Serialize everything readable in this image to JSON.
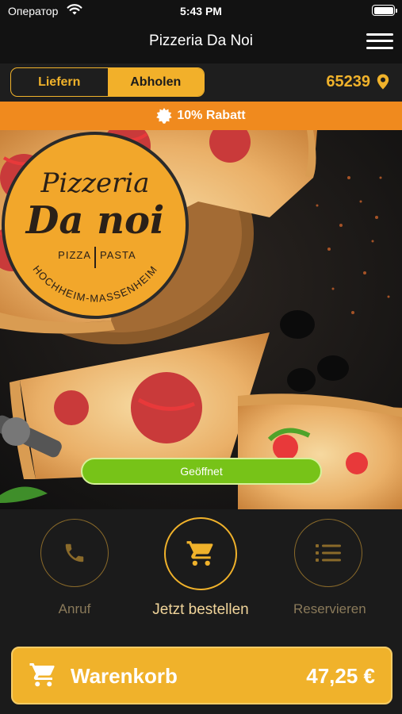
{
  "status_bar": {
    "carrier": "Оператор",
    "time": "5:43 PM"
  },
  "nav": {
    "title": "Pizzeria Da Noi",
    "menu_icon": "hamburger-menu-icon"
  },
  "mode": {
    "delivery_label": "Liefern",
    "pickup_label": "Abholen",
    "selected": "Abholen",
    "zip": "65239",
    "location_icon": "location-pin-icon"
  },
  "discount": {
    "icon": "gear-badge-icon",
    "text": "10% Rabatt"
  },
  "logo": {
    "line1": "Pizzeria",
    "line2": "Da noi",
    "tag_left": "PIZZA",
    "tag_right": "PASTA",
    "arc_text": "HOCHHEIM-MASSENHEIM"
  },
  "open_status": "Geöffnet",
  "actions": {
    "call": {
      "label": "Anruf",
      "icon": "phone-icon"
    },
    "order": {
      "label": "Jetzt bestellen",
      "icon": "cart-icon"
    },
    "reserve": {
      "label": "Reservieren",
      "icon": "list-icon"
    }
  },
  "cart": {
    "label": "Warenkorb",
    "total": "47,25 €",
    "icon": "cart-icon"
  },
  "colors": {
    "accent": "#f0b22b",
    "banner": "#f08a1e",
    "open": "#77c318",
    "background": "#1b1b1b"
  }
}
